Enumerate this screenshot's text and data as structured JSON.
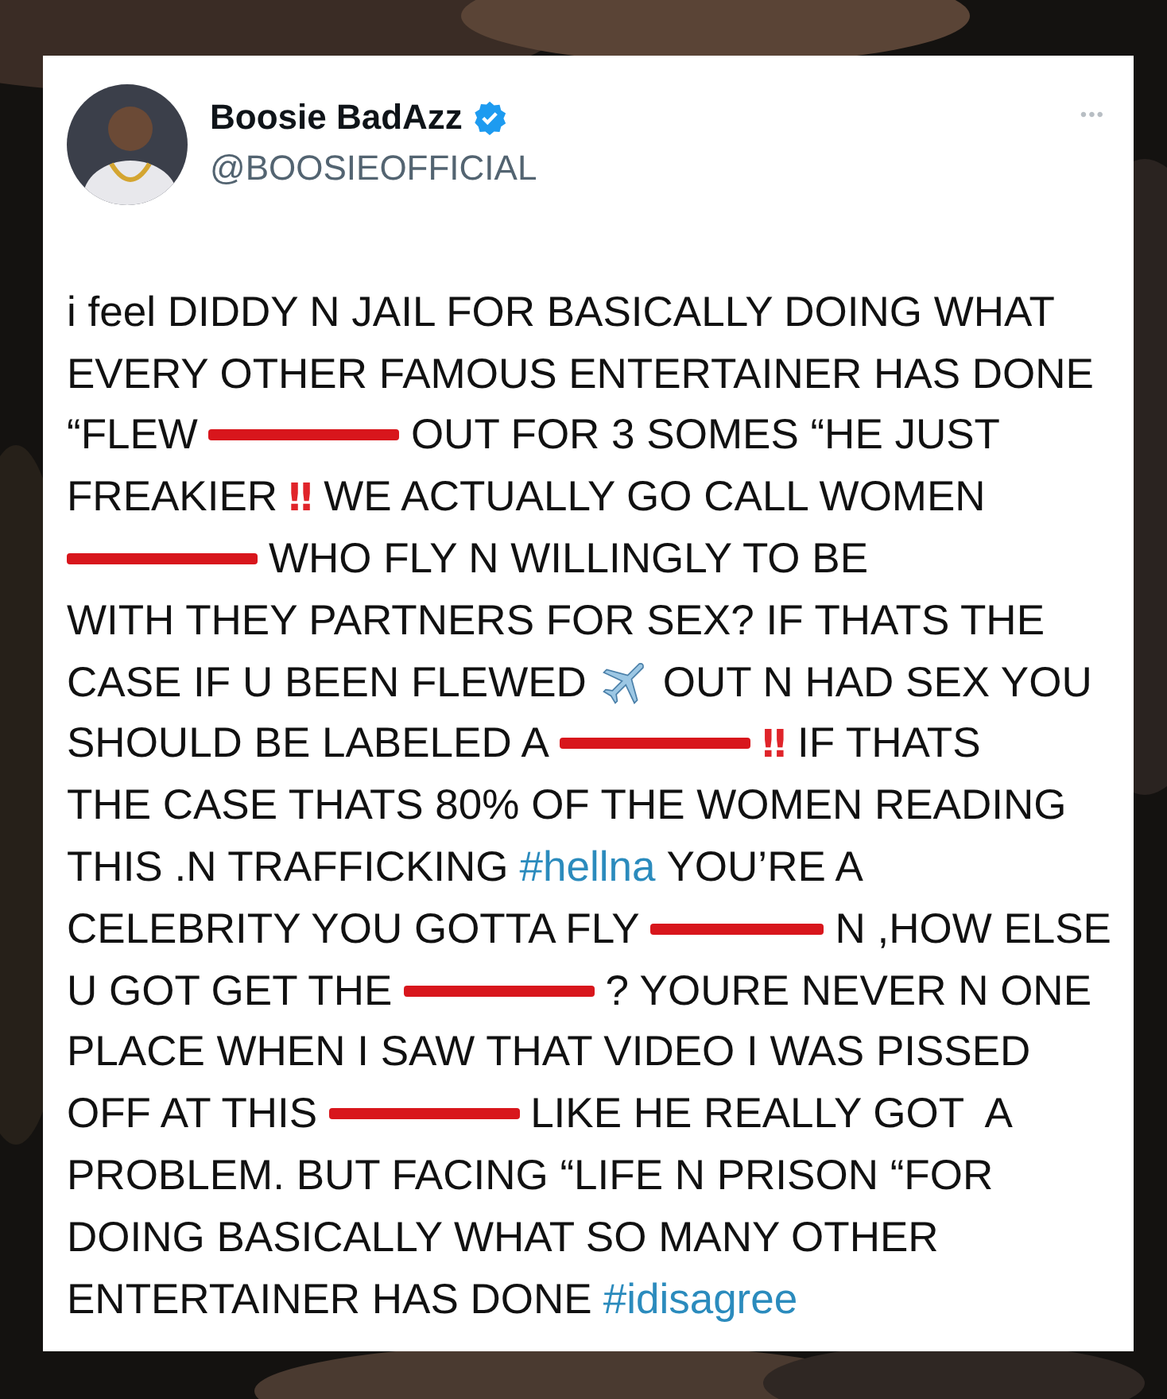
{
  "tweet": {
    "author": {
      "name": "Boosie BadAzz",
      "verified": true,
      "handle": "@BOOSIEOFFICIAL"
    },
    "more": "•••",
    "lines": [
      [
        {
          "kind": "text",
          "text": "i feel DIDDY N JAIL FOR BASICALLY DOING WHAT"
        }
      ],
      [
        {
          "kind": "text",
          "text": "EVERY OTHER FAMOUS ENTERTAINER HAS DONE"
        }
      ],
      [
        {
          "kind": "text",
          "text": "“FLEW"
        },
        {
          "kind": "redaction"
        },
        {
          "kind": "text",
          "text": "OUT FOR 3 SOMES “HE JUST"
        }
      ],
      [
        {
          "kind": "text",
          "text": "FREAKIER"
        },
        {
          "kind": "emoji",
          "text": "‼"
        },
        {
          "kind": "text",
          "text": "WE ACTUALLY GO CALL WOMEN"
        }
      ],
      [
        {
          "kind": "redaction"
        },
        {
          "kind": "text",
          "text": "WHO FLY N WILLINGLY TO BE"
        }
      ],
      [
        {
          "kind": "text",
          "text": "WITH THEY PARTNERS FOR SEX? IF THATS THE"
        }
      ],
      [
        {
          "kind": "text",
          "text": "CASE IF U BEEN FLEWED"
        },
        {
          "kind": "plane"
        },
        {
          "kind": "text",
          "text": "OUT N HAD SEX YOU"
        }
      ],
      [
        {
          "kind": "text",
          "text": "SHOULD BE LABELED A"
        },
        {
          "kind": "redaction"
        },
        {
          "kind": "emoji",
          "text": "‼"
        },
        {
          "kind": "text",
          "text": "IF THATS"
        }
      ],
      [
        {
          "kind": "text",
          "text": "THE CASE THATS 80% OF THE WOMEN READING"
        }
      ],
      [
        {
          "kind": "text",
          "text": "THIS .N TRAFFICKING"
        },
        {
          "kind": "hashtag",
          "text": "#hellna"
        },
        {
          "kind": "text",
          "text": "YOU’RE A"
        }
      ],
      [
        {
          "kind": "text",
          "text": "CELEBRITY YOU GOTTA FLY"
        },
        {
          "kind": "redaction"
        },
        {
          "kind": "text",
          "text": "N ,HOW ELSE"
        }
      ],
      [
        {
          "kind": "text",
          "text": "U GOT GET THE"
        },
        {
          "kind": "redaction"
        },
        {
          "kind": "text",
          "text": "? YOURE NEVER N ONE"
        }
      ],
      [
        {
          "kind": "text",
          "text": "PLACE WHEN I SAW THAT VIDEO I WAS PISSED"
        }
      ],
      [
        {
          "kind": "text",
          "text": "OFF AT THIS"
        },
        {
          "kind": "redaction"
        },
        {
          "kind": "text",
          "text": "LIKE HE REALLY GOT  A"
        }
      ],
      [
        {
          "kind": "text",
          "text": "PROBLEM. BUT FACING “LIFE N PRISON “FOR"
        }
      ],
      [
        {
          "kind": "text",
          "text": "DOING BASICALLY WHAT SO MANY OTHER"
        }
      ],
      [
        {
          "kind": "text",
          "text": "ENTERTAINER HAS DONE"
        },
        {
          "kind": "hashtag",
          "text": "#idisagree"
        }
      ]
    ]
  }
}
